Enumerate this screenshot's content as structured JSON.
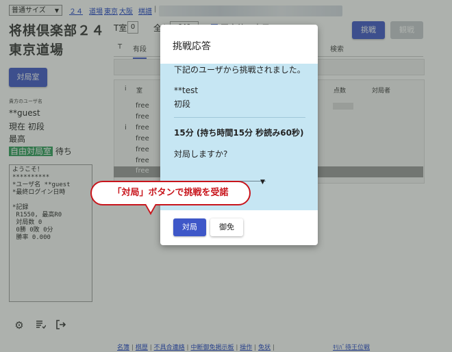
{
  "topbar": {
    "size_select": "普通サイズ",
    "links": [
      "２４",
      "道場",
      "東京",
      "大阪",
      "棋譜"
    ]
  },
  "site": {
    "title1": "将棋倶楽部２４",
    "title2": "東京道場"
  },
  "header": {
    "room_label": "T室",
    "room_value": "0",
    "room2_label": "全入数",
    "room2_value": "640",
    "checkbox_label": "同室待つ表示",
    "challenge_button": "挑戦",
    "view_button": "観戦"
  },
  "tabs": [
    "T",
    "有段",
    "検索"
  ],
  "battle_room_button": "対局室",
  "table": {
    "headers": [
      "i",
      "室",
      "点数",
      "対局者"
    ],
    "rows": [
      {
        "i": "",
        "room": "free"
      },
      {
        "i": "",
        "room": "free"
      },
      {
        "i": "i",
        "room": "free"
      },
      {
        "i": "",
        "room": "free"
      },
      {
        "i": "",
        "room": "free"
      },
      {
        "i": "",
        "room": "free"
      },
      {
        "i": "",
        "room": "free"
      }
    ]
  },
  "sidebar": {
    "section_label": "貴方のユーザ名",
    "username": "**guest",
    "current_rank": "現在 初段",
    "highest": "最高",
    "free_room": "自由対局室",
    "waiting": "待ち"
  },
  "message_log": "ようこそ！\n**********\n*ユーザ名 **guest\n*最終ログイン日時\n\n*記録\n R1550, 最高R0\n 対局数 0\n 0勝 0敗 0分\n 勝率 0.000",
  "icons": [
    "gear-icon",
    "list-icon",
    "logout-icon"
  ],
  "footer": {
    "links": [
      "名簿",
      "棋歴",
      "不具合連絡",
      "中断御免掲示板",
      "操作",
      "免状"
    ],
    "right_link": "ｷﾘﾊﾞ待王位戦"
  },
  "modal": {
    "title": "挑戦応答",
    "intro": "下記のユーザから挑戦されました。",
    "challenger_name": "**test",
    "challenger_rank": "初段",
    "time_control": "15分 (持ち時間15分 秒読み60秒)",
    "question": "対局しますか?",
    "accept_button": "対局",
    "decline_button": "御免"
  },
  "callout": {
    "text": "「対局」ボタンで挑戦を受諾"
  },
  "colors": {
    "primary": "#3e57c8",
    "modal_body": "#c6e6f3",
    "callout_red": "#c8141b",
    "free_room_green": "#2e9e5b"
  }
}
